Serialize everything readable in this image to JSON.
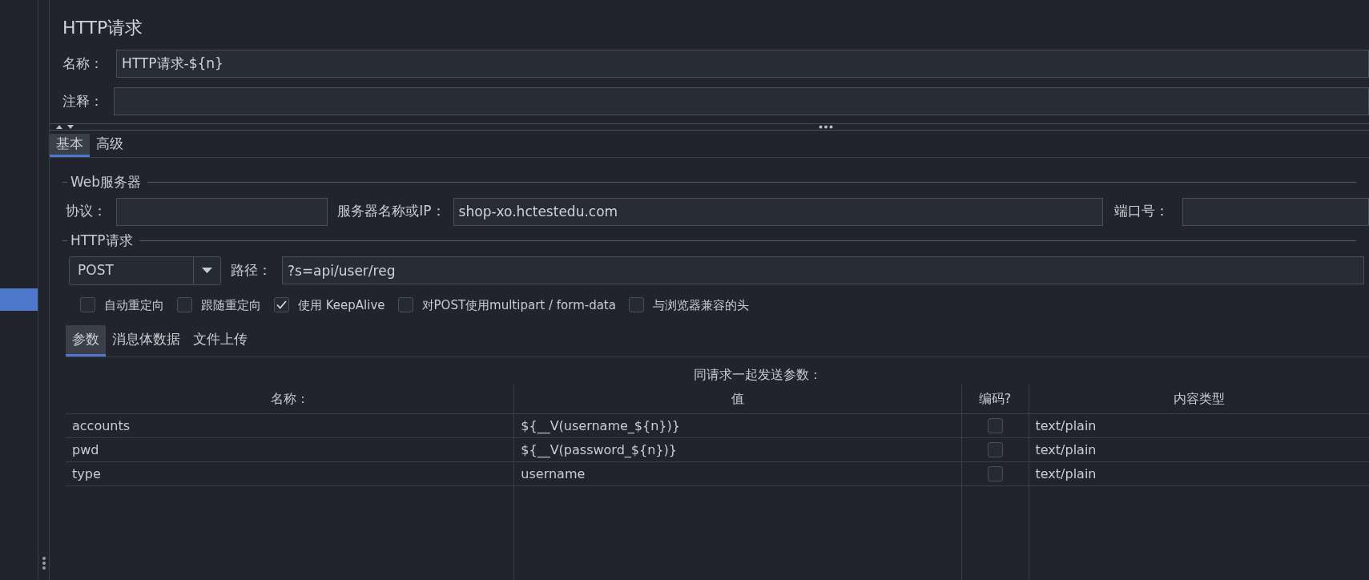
{
  "sidebar": {
    "items": [
      {
        "selected": true
      }
    ]
  },
  "title": "HTTP请求",
  "name_field": {
    "label": "名称：",
    "value": "HTTP请求-${n}"
  },
  "comment_field": {
    "label": "注释："
  },
  "tabs": [
    {
      "label": "基本",
      "selected": true
    },
    {
      "label": "高级",
      "selected": false
    }
  ],
  "web_server": {
    "legend": "Web服务器",
    "protocol_label": "协议：",
    "server_label": "服务器名称或IP：",
    "server_value": "shop-xo.hctestedu.com",
    "port_label": "端口号："
  },
  "http_request": {
    "legend": "HTTP请求",
    "method": "POST",
    "path_label": "路径：",
    "path_value": "?s=api/user/reg"
  },
  "options": [
    {
      "label": "自动重定向",
      "checked": false
    },
    {
      "label": "跟随重定向",
      "checked": false
    },
    {
      "label": "使用 KeepAlive",
      "checked": true
    },
    {
      "label": "对POST使用multipart / form-data",
      "checked": false
    },
    {
      "label": "与浏览器兼容的头",
      "checked": false
    }
  ],
  "sub_tabs": [
    {
      "label": "参数",
      "selected": true
    },
    {
      "label": "消息体数据",
      "selected": false
    },
    {
      "label": "文件上传",
      "selected": false
    }
  ],
  "params_caption": "同请求一起发送参数：",
  "table": {
    "columns": [
      "名称：",
      "值",
      "编码?",
      "内容类型"
    ],
    "rows": [
      {
        "name": "accounts",
        "value": "${__V(username_${n})}",
        "encode": false,
        "content_type": "text/plain"
      },
      {
        "name": "pwd",
        "value": "${__V(password_${n})}",
        "encode": false,
        "content_type": "text/plain"
      },
      {
        "name": "type",
        "value": "username",
        "encode": false,
        "content_type": "text/plain"
      }
    ]
  }
}
